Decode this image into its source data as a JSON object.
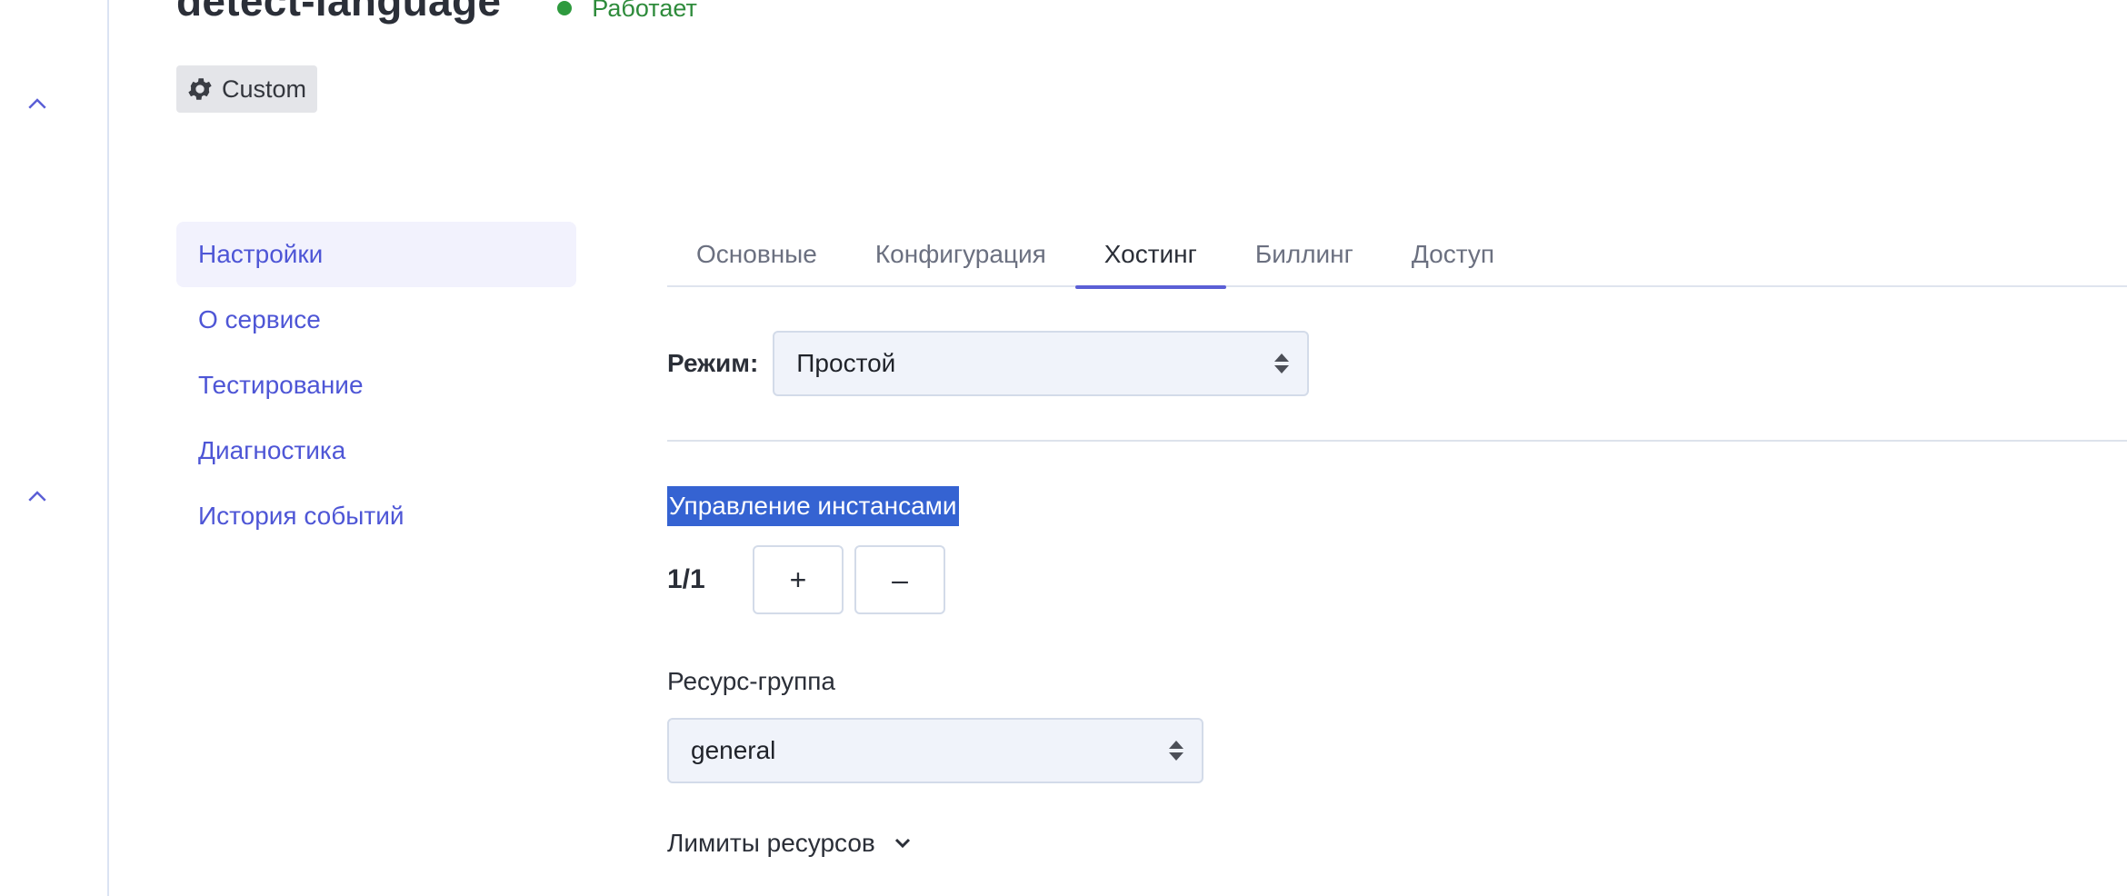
{
  "header": {
    "title": "detect-language",
    "status": "Работает",
    "badge": "Custom"
  },
  "rail": {
    "icons": [
      "chevron-up-icon",
      "chevron-up-icon"
    ]
  },
  "leftnav": {
    "items": [
      {
        "label": "Настройки",
        "active": true
      },
      {
        "label": "О сервисе",
        "active": false
      },
      {
        "label": "Тестирование",
        "active": false
      },
      {
        "label": "Диагностика",
        "active": false
      },
      {
        "label": "История событий",
        "active": false
      }
    ]
  },
  "tabs": [
    {
      "label": "Основные",
      "active": false
    },
    {
      "label": "Конфигурация",
      "active": false
    },
    {
      "label": "Хостинг",
      "active": true
    },
    {
      "label": "Биллинг",
      "active": false
    },
    {
      "label": "Доступ",
      "active": false
    }
  ],
  "hosting": {
    "mode_label": "Режим:",
    "mode_value": "Простой",
    "instances_title": "Управление инстансами",
    "instances_count": "1/1",
    "plus": "+",
    "minus": "–",
    "resource_group_label": "Ресурс-группа",
    "resource_group_value": "general",
    "limits_label": "Лимиты ресурсов"
  },
  "colors": {
    "accent": "#5b5fd6",
    "link": "#4e56d6",
    "status_green": "#2e9a3e",
    "selection": "#3563d2"
  }
}
